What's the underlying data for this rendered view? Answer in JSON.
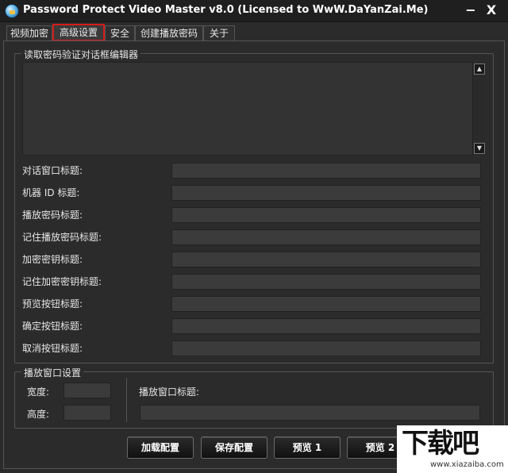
{
  "window": {
    "title": "Password Protect Video Master v8.0 (Licensed to WwW.DaYanZai.Me)",
    "minimize_glyph": "−",
    "close_glyph": "X"
  },
  "tabs": [
    {
      "label": "视频加密",
      "active": false
    },
    {
      "label": "高级设置",
      "active": true
    },
    {
      "label": "安全",
      "active": false
    },
    {
      "label": "创建播放密码",
      "active": false
    },
    {
      "label": "关于",
      "active": false
    }
  ],
  "editor_group": {
    "legend": "读取密码验证对话框编辑器",
    "scroll_up_glyph": "▲",
    "scroll_down_glyph": "▼"
  },
  "fields": [
    {
      "label": "对话窗口标题:",
      "value": ""
    },
    {
      "label": "机器 ID 标题:",
      "value": ""
    },
    {
      "label": "播放密码标题:",
      "value": ""
    },
    {
      "label": "记住播放密码标题:",
      "value": ""
    },
    {
      "label": "加密密钥标题:",
      "value": ""
    },
    {
      "label": "记住加密密钥标题:",
      "value": ""
    },
    {
      "label": "预览按钮标题:",
      "value": ""
    },
    {
      "label": "确定按钮标题:",
      "value": ""
    },
    {
      "label": "取消按钮标题:",
      "value": ""
    }
  ],
  "player_group": {
    "legend": "播放窗口设置",
    "width_label": "宽度:",
    "width_value": "",
    "height_label": "高度:",
    "height_value": "",
    "title_label": "播放窗口标题:",
    "title_value": ""
  },
  "buttons": {
    "load": "加载配置",
    "save": "保存配置",
    "preview1": "预览 1",
    "preview2": "预览 2"
  },
  "watermark": {
    "main": "下载吧",
    "sub": "www.xiazaiba.com"
  },
  "colors": {
    "background": "#2b2b2b",
    "active_tab_border": "#d21b1b",
    "input_bg": "#3b3b3b"
  },
  "icons": {
    "app": "app-shield-icon"
  }
}
